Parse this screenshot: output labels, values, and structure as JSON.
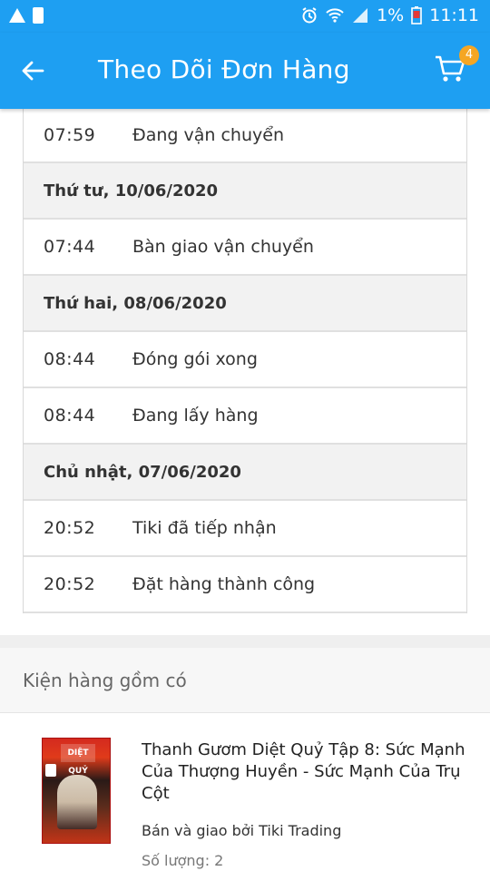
{
  "status_bar": {
    "battery": "1%",
    "time": "11:11",
    "icons": [
      "warning-icon",
      "sim-icon",
      "alarm-icon",
      "wifi-icon",
      "signal-icon",
      "battery-low-icon"
    ]
  },
  "app_bar": {
    "title": "Theo Dõi Đơn Hàng",
    "back_icon": "arrow-left-icon",
    "cart_icon": "cart-icon",
    "cart_badge": "4",
    "colors": {
      "primary": "#1e9ff2",
      "badge": "#f5a623"
    }
  },
  "timeline": [
    {
      "type": "event",
      "time": "07:59",
      "status": "Đang vận chuyển"
    },
    {
      "type": "date",
      "label": "Thứ tư, 10/06/2020"
    },
    {
      "type": "event",
      "time": "07:44",
      "status": "Bàn giao vận chuyển"
    },
    {
      "type": "date",
      "label": "Thứ hai, 08/06/2020"
    },
    {
      "type": "event",
      "time": "08:44",
      "status": "Đóng gói xong"
    },
    {
      "type": "event",
      "time": "08:44",
      "status": "Đang lấy hàng"
    },
    {
      "type": "date",
      "label": "Chủ nhật, 07/06/2020"
    },
    {
      "type": "event",
      "time": "20:52",
      "status": "Tiki đã tiếp nhận"
    },
    {
      "type": "event",
      "time": "20:52",
      "status": "Đặt hàng thành công"
    }
  ],
  "package": {
    "heading": "Kiện hàng gồm có",
    "product": {
      "title": "Thanh Gươm Diệt Quỷ Tập 8: Sức Mạnh Của Thượng Huyền - Sức Mạnh Của Trụ Cột",
      "seller": "Bán và giao bởi Tiki Trading",
      "quantity": "Số lượng: 2"
    }
  }
}
